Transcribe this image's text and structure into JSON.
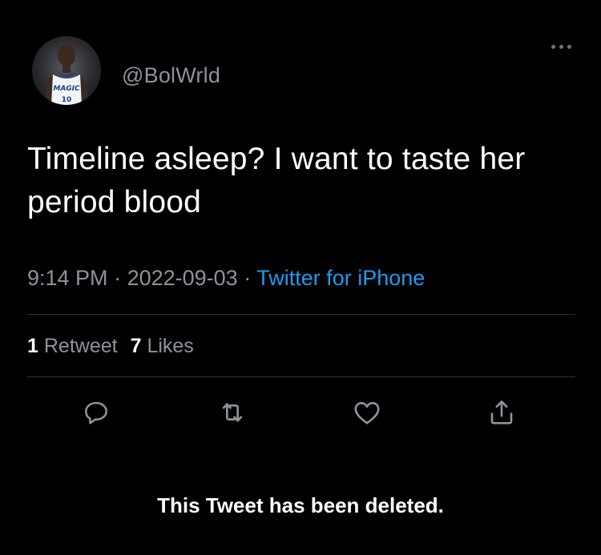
{
  "tweet": {
    "author": {
      "handle": "@BolWrld",
      "jersey_text": "MAGIC",
      "jersey_number": "10"
    },
    "text": "Timeline asleep? I want to taste her period blood",
    "time": "9:14 PM",
    "separator": "·",
    "date": "2022-09-03",
    "source": "Twitter for iPhone",
    "retweet_count": "1",
    "retweet_label": "Retweet",
    "like_count": "7",
    "like_label": "Likes"
  },
  "actions": {
    "icons": [
      "reply-icon",
      "retweet-icon",
      "like-icon",
      "share-icon"
    ]
  },
  "notice": {
    "deleted_text": "This Tweet has been deleted."
  },
  "colors": {
    "background": "#000000",
    "text_primary": "#ffffff",
    "text_secondary": "#8b949b",
    "link": "#1d9bf0",
    "divider": "#2f3336",
    "icon": "#8b949b"
  }
}
